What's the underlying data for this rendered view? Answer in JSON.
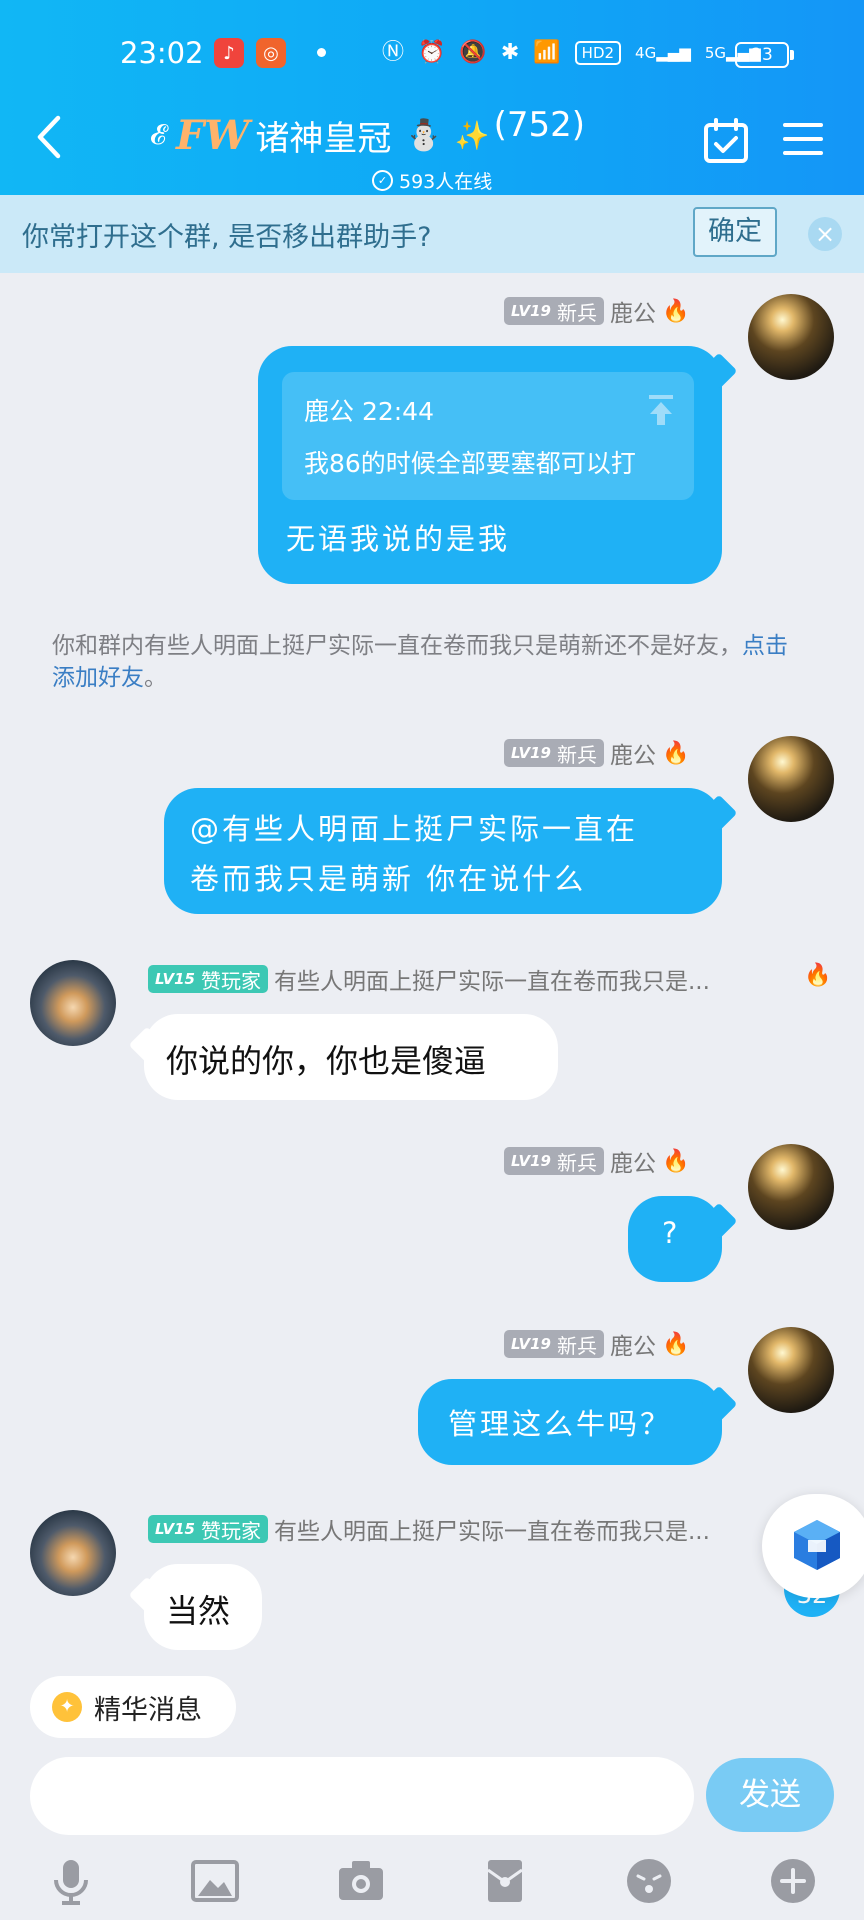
{
  "status_bar": {
    "time": "23:02",
    "icons": [
      "music-app-icon",
      "kuaishou-app-icon",
      "nfc-icon",
      "alarm-icon",
      "mute-icon",
      "bluetooth-icon",
      "wifi-icon",
      "hd-icon",
      "signal-4g-icon",
      "signal-5g-icon"
    ],
    "hd_label": "HD2",
    "net1": "4G",
    "net2": "5G",
    "battery": "23"
  },
  "header": {
    "title_prefix": "FW",
    "title_name": "诸神皇冠",
    "member_count": "(752)",
    "online_text": "593人在线",
    "colors": {
      "start": "#11b7f5",
      "end": "#1496f7"
    }
  },
  "banner": {
    "text": "你常打开这个群, 是否移出群助手?",
    "confirm_label": "确定"
  },
  "messages": [
    {
      "side": "right",
      "level": "LV19",
      "title": "新兵",
      "sender": "鹿公",
      "quote_header": "鹿公 22:44",
      "quote_text": "我86的时候全部要塞都可以打",
      "text": "无语我说的是我"
    },
    {
      "side": "right",
      "level": "LV19",
      "title": "新兵",
      "sender": "鹿公",
      "text_line1": "@有些人明面上挺尸实际一直在",
      "text_line2": "卷而我只是萌新 你在说什么"
    },
    {
      "side": "left",
      "level": "LV15",
      "title": "赞玩家",
      "sender": "有些人明面上挺尸实际一直在卷而我只是...",
      "text": "你说的你，你也是傻逼"
    },
    {
      "side": "right",
      "level": "LV19",
      "title": "新兵",
      "sender": "鹿公",
      "text": "?"
    },
    {
      "side": "right",
      "level": "LV19",
      "title": "新兵",
      "sender": "鹿公",
      "text": "管理这么牛吗？"
    },
    {
      "side": "left",
      "level": "LV15",
      "title": "赞玩家",
      "sender": "有些人明面上挺尸实际一直在卷而我只是...",
      "text": "当然"
    }
  ],
  "system_notice": {
    "text": "你和群内有些人明面上挺尸实际一直在卷而我只是萌新还不是好友，",
    "link": "点击添加好友",
    "suffix": "。"
  },
  "unread_count": "32",
  "essence_label": "精华消息",
  "input": {
    "placeholder": "",
    "send_label": "发送"
  },
  "toolbar": [
    "microphone-icon",
    "image-icon",
    "camera-icon",
    "red-packet-icon",
    "emoji-icon",
    "plus-icon"
  ]
}
